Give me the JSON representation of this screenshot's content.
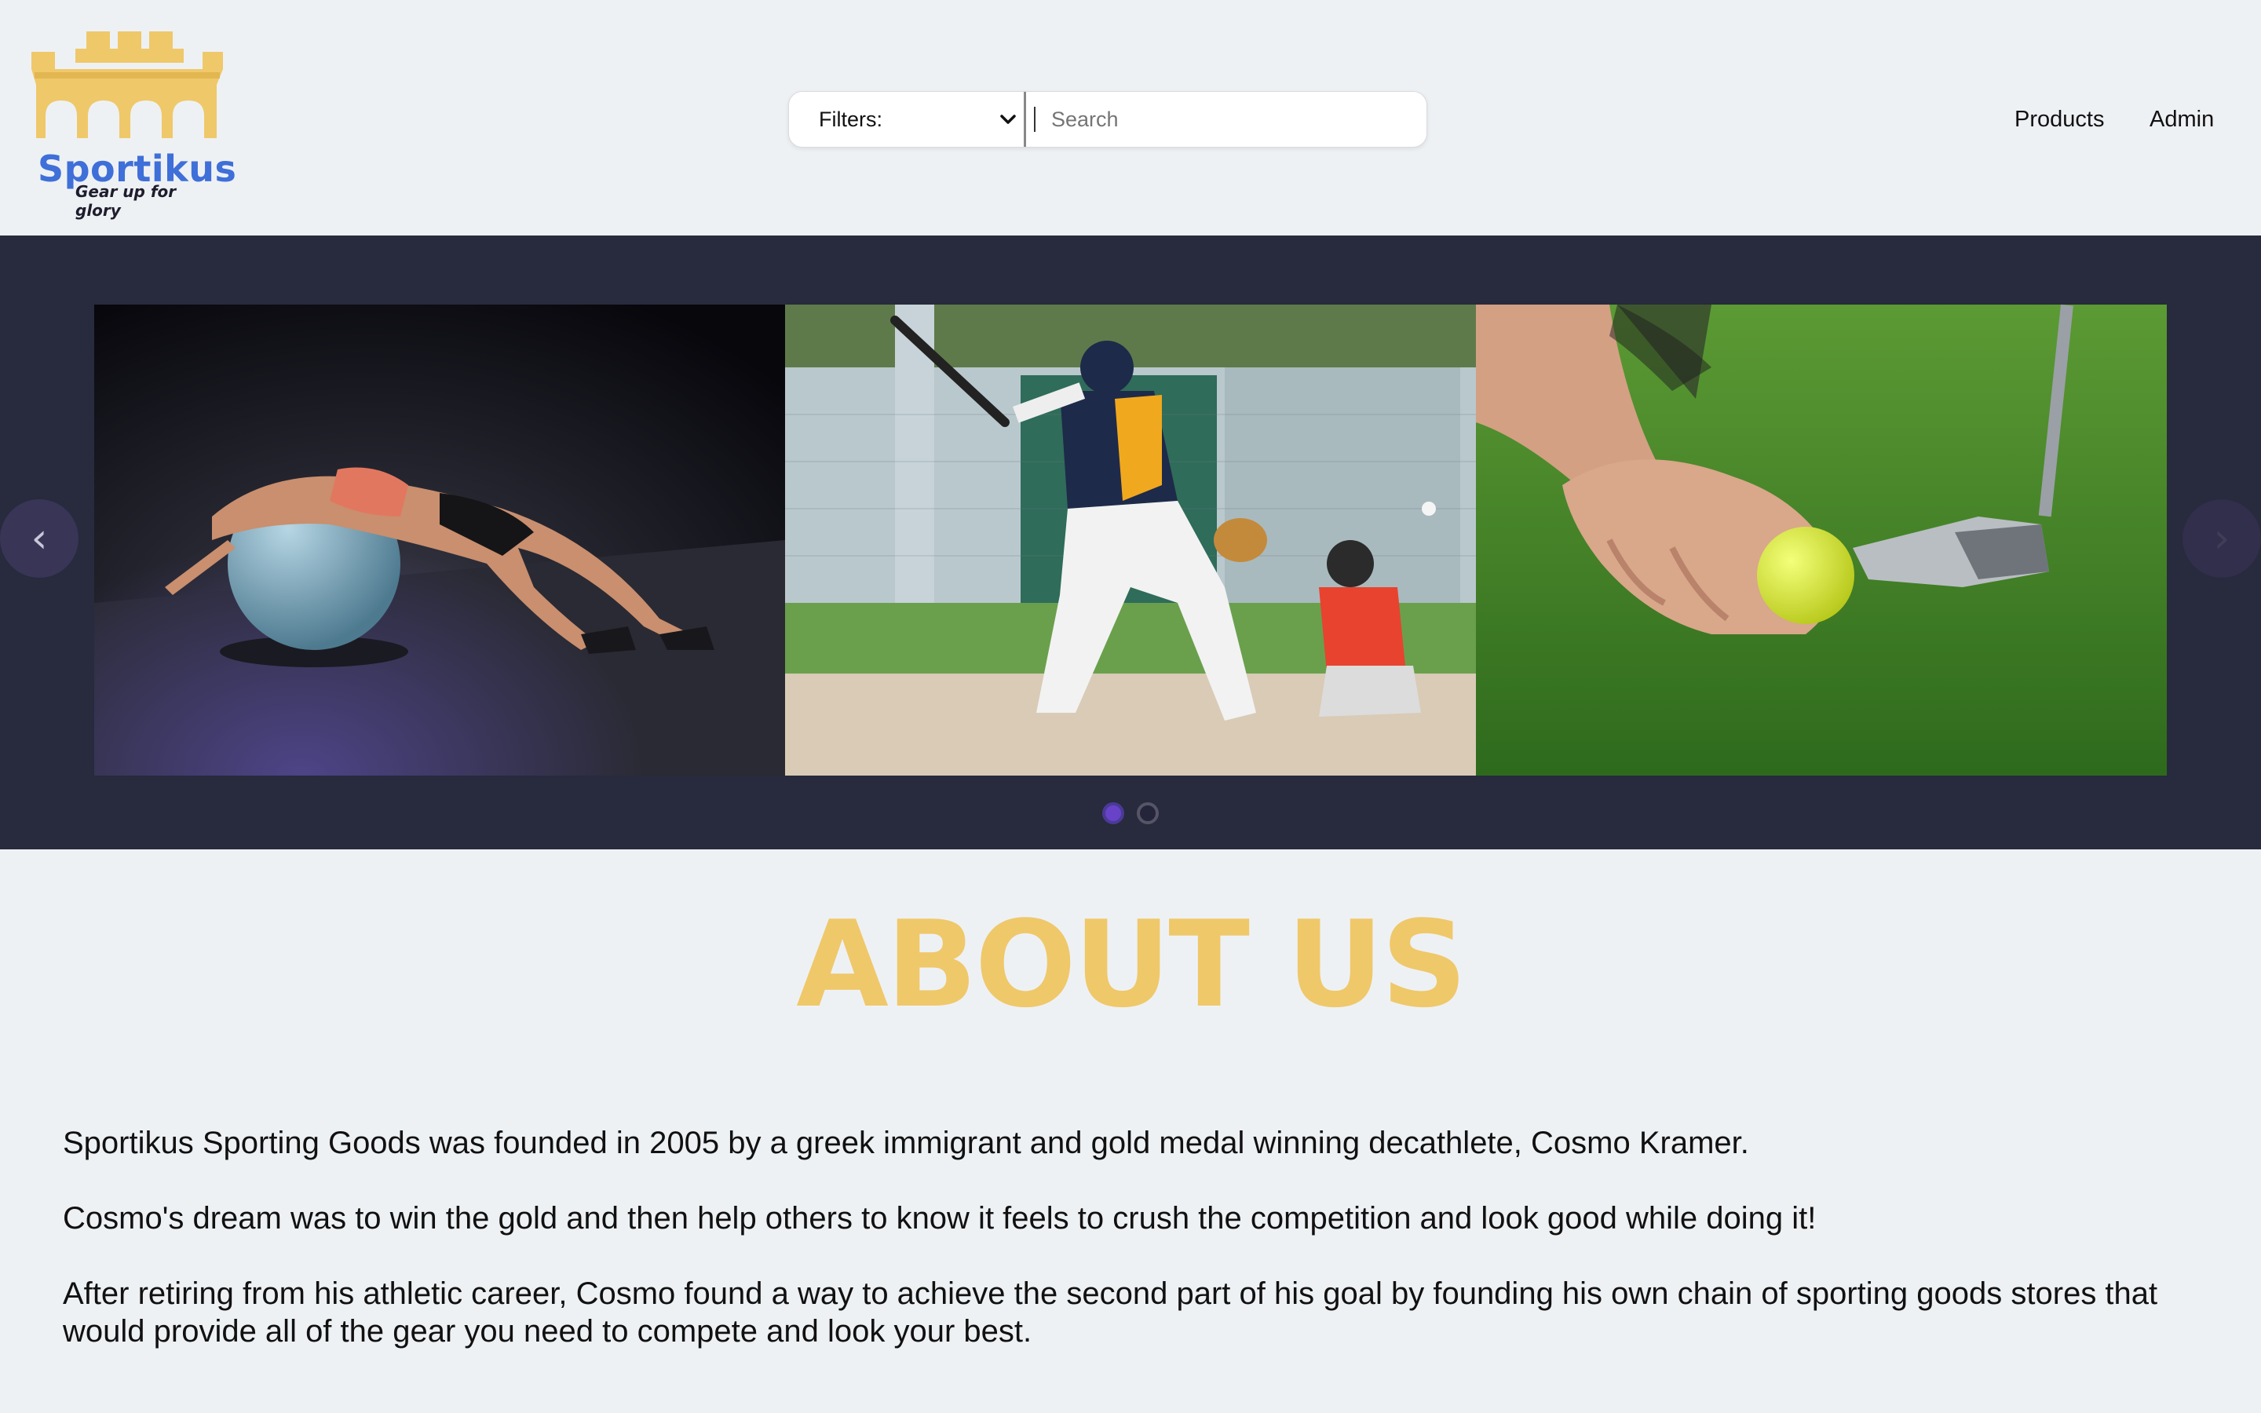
{
  "brand": {
    "name": "Sportikus",
    "tagline": "Gear up for glory",
    "colors": {
      "gold": "#efc86a",
      "blue": "#3f6fd8",
      "dark_band": "#282a3d",
      "accent_purple": "#6843c8"
    }
  },
  "header": {
    "filter": {
      "selected": "Filters:",
      "icon": "chevron-down-icon"
    },
    "search": {
      "placeholder": "Search",
      "icon": "none"
    },
    "nav": [
      {
        "label": "Products"
      },
      {
        "label": "Admin"
      }
    ]
  },
  "carousel": {
    "prev_label": "‹",
    "next_label": "›",
    "slides": [
      {
        "alt": "fitness-ball-stretch"
      },
      {
        "alt": "baseball-batter-and-catcher"
      },
      {
        "alt": "golf-ball-and-putter"
      }
    ],
    "active_page": 1,
    "page_count": 2
  },
  "about": {
    "heading": "ABOUT US",
    "paragraphs": [
      "Sportikus Sporting Goods was founded in 2005 by a greek immigrant and gold medal winning decathlete, Cosmo Kramer.",
      "Cosmo's dream was to win the gold and then help others to know it feels to crush the competition and look good while doing it!",
      "After retiring from his athletic career, Cosmo found a way to achieve the second part of his goal by founding his own chain of sporting goods stores that would provide all of the gear you need to compete and look your best."
    ]
  }
}
